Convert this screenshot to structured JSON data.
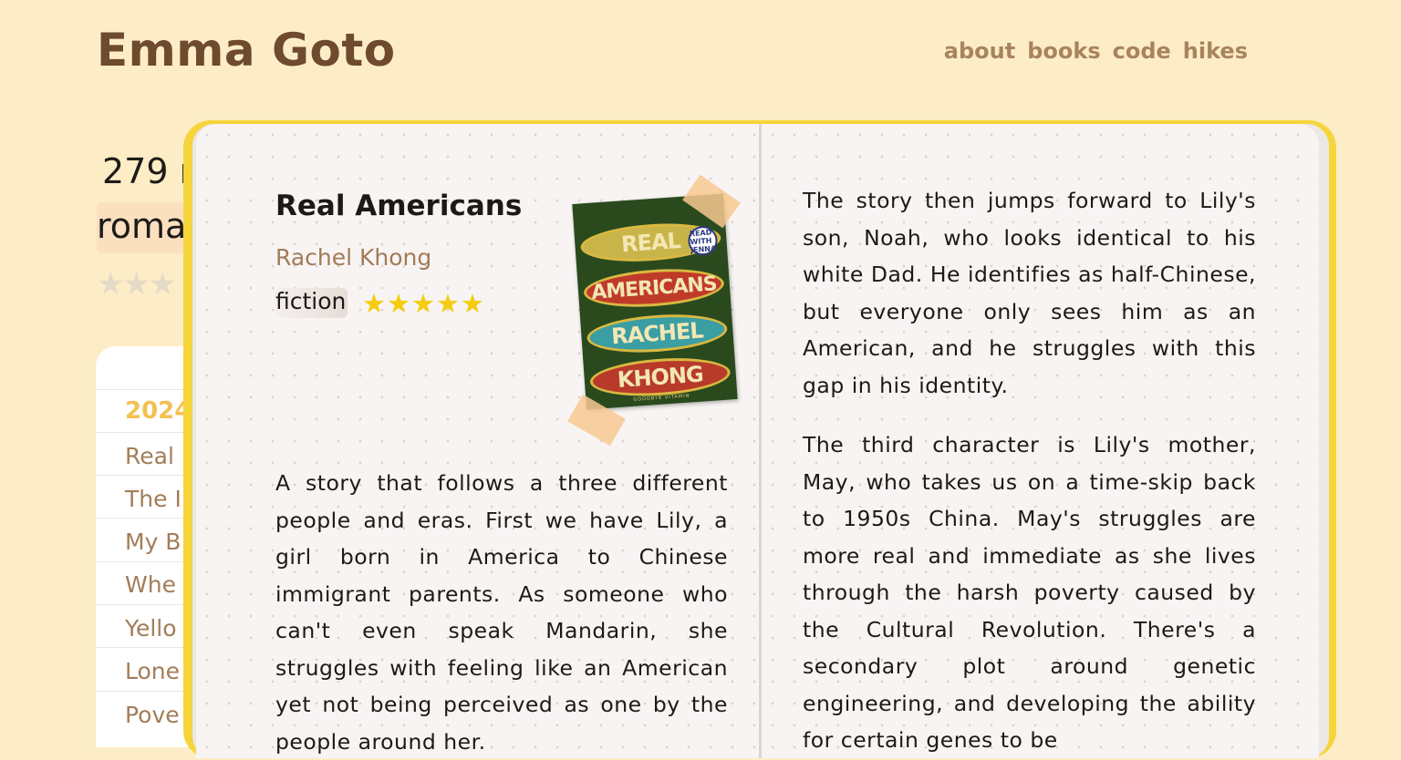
{
  "site": {
    "title": "Emma Goto",
    "nav": [
      "about",
      "books",
      "code",
      "hikes"
    ]
  },
  "background": {
    "stat_line": "279 r",
    "stat_tag": "roma",
    "rating_stars": "★★★",
    "list": {
      "year": "2024",
      "items": [
        "Real ",
        "The I",
        "My B",
        "Whe",
        "Yello",
        "Lone",
        "Pove"
      ]
    }
  },
  "book": {
    "title": "Real Americans",
    "author": "Rachel Khong",
    "genre": "fiction",
    "rating": 5,
    "stars": "★★★★★",
    "cover": {
      "lines": [
        "REAL",
        "AMERICANS",
        "RACHEL",
        "KHONG"
      ],
      "badge": "READ WITH JENNA",
      "footer": "GOODBYE VITAMIN"
    },
    "review": [
      "A story that follows a three different people and eras. First we have Lily, a girl born in America to Chinese immigrant parents. As someone who can't even speak Mandarin, she struggles with feeling like an American yet not being perceived as one by the people around her.",
      "The story then jumps forward to Lily's son, Noah, who looks identical to his white Dad. He identifies as half-Chinese, but everyone only sees him as an American, and he struggles with this gap in his identity.",
      "The third character is Lily's mother, May, who takes us on a time-skip back to 1950s China. May's struggles are more real and immediate as she lives through the harsh poverty caused by the Cultural Revolution. There's a secondary plot around genetic engineering, and developing the ability for certain genes to be"
    ]
  },
  "colors": {
    "background": "#fdedc6",
    "title": "#6e4a2e",
    "nav": "#a8845e",
    "accent_yellow": "#f6d43c",
    "star": "#f4cd10",
    "author": "#a27b57"
  }
}
